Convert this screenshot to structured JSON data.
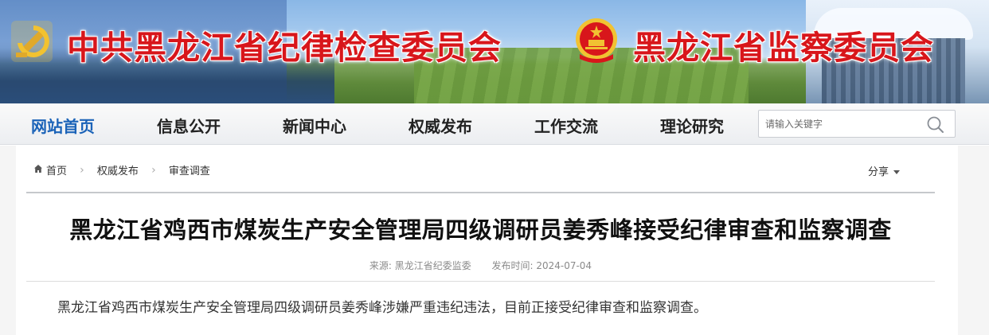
{
  "header": {
    "title_left": "中共黑龙江省纪律检查委员会",
    "title_right": "黑龙江省监察委员会",
    "brand_red": "#d8161b"
  },
  "nav": {
    "items": [
      {
        "label": "网站首页",
        "active": true
      },
      {
        "label": "信息公开",
        "active": false
      },
      {
        "label": "新闻中心",
        "active": false
      },
      {
        "label": "权威发布",
        "active": false
      },
      {
        "label": "工作交流",
        "active": false
      },
      {
        "label": "理论研究",
        "active": false
      }
    ],
    "active_color": "#1b63b8",
    "search": {
      "placeholder": "请输入关键字",
      "icon": "search-icon"
    }
  },
  "breadcrumb": {
    "items": [
      "首页",
      "权威发布",
      "审查调查"
    ],
    "home_icon": "home-icon"
  },
  "share": {
    "label": "分享"
  },
  "article": {
    "title": "黑龙江省鸡西市煤炭生产安全管理局四级调研员姜秀峰接受纪律审查和监察调查",
    "source_label": "来源:",
    "source": "黑龙江省纪委监委",
    "date_label": "发布时间:",
    "date": "2024-07-04",
    "body": "黑龙江省鸡西市煤炭生产安全管理局四级调研员姜秀峰涉嫌严重违纪违法，目前正接受纪律审查和监察调查。"
  }
}
